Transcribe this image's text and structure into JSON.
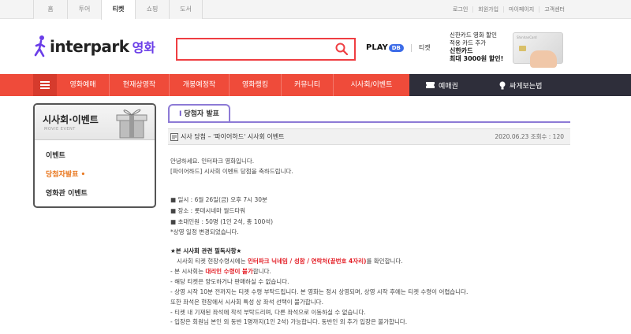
{
  "site_tabs": [
    "투어",
    "티켓",
    "쇼핑",
    "도서"
  ],
  "site_tab_home": "홈",
  "util_links": [
    "로그인",
    "회원가입",
    "마이페이지",
    "고객센터"
  ],
  "logo": {
    "text": "interpark",
    "sub": "영화"
  },
  "search": {
    "placeholder": ""
  },
  "play": {
    "label": "PLAY",
    "pill": "DB",
    "ticket": "티켓"
  },
  "promo": {
    "line1": "신한카드 영화 할인",
    "line2": "적용 카드 추가",
    "line3": "신한카드",
    "line4": "최대 3000원 할인!",
    "card_brand": "ShinhanCard"
  },
  "gnb": {
    "items": [
      "영화예매",
      "현재상영작",
      "개봉예정작",
      "영화랭킹",
      "커뮤니티",
      "시사회/이벤트"
    ],
    "right1": "예매권",
    "right2": "싸게보는법"
  },
  "lnb": {
    "title": "시사회·이벤트",
    "sub": "MOVIE EVENT",
    "items": [
      "이벤트",
      "당첨자발표",
      "영화관 이벤트"
    ],
    "active_marker": "•"
  },
  "board": {
    "tab_marker": "I",
    "tab_label": "당첨자 발표",
    "post_title": "시사 당첨 – '파이어하드' 시사회 이벤트",
    "post_date": "2020.06.23",
    "views_label": "조회수 : 120"
  },
  "content": {
    "l1": "안녕하세요. 인터파크 영화입니다.",
    "l2": "[파이어하드] 시사회 이벤트 당첨을 축하드립니다.",
    "l3": "■ 일시 : 6월 26일(금) 오후 7시 30분",
    "l4": "■ 장소 : 롯데시네마 월드타워",
    "l5": "■ 초대인원 : 50명 (1인 2석, 총 100석)",
    "l6": "*상영 일정 변경되었습니다.",
    "l7": "★본 시사회 관련 필독사항★",
    "l8a": "시사회 티켓 현장수령시에는 ",
    "l8b": "인터파크 닉네임 / 성함 / 연락처(끝번호 4자리)",
    "l8c": "를 확인합니다.",
    "l9a": "- 본 시사회는 ",
    "l9b": "대리인 수령이 불가",
    "l9c": "합니다.",
    "l10": "- 해당 티켓은 양도하거나 판매하실 수 없습니다.",
    "l11": "- 상영 시작 10분 전까지는 티켓 수령 부탁드립니다. 본 영화는 정시 상영되며, 상영 시작 후에는 티켓 수령이 어렵습니다.",
    "l12": "  또한 좌석은 현장에서 시사회 특성 상 좌석 선택이 불가합니다.",
    "l13": "- 티켓 내 기재된 좌석에 착석 부탁드리며, 다른 좌석으로 이동하실 수 없습니다.",
    "l14": "- 입장은 회원님 본인 외 동반 1명까지(1인 2석) 가능합니다. 동반인 외 추가 입장은 불가합니다."
  }
}
